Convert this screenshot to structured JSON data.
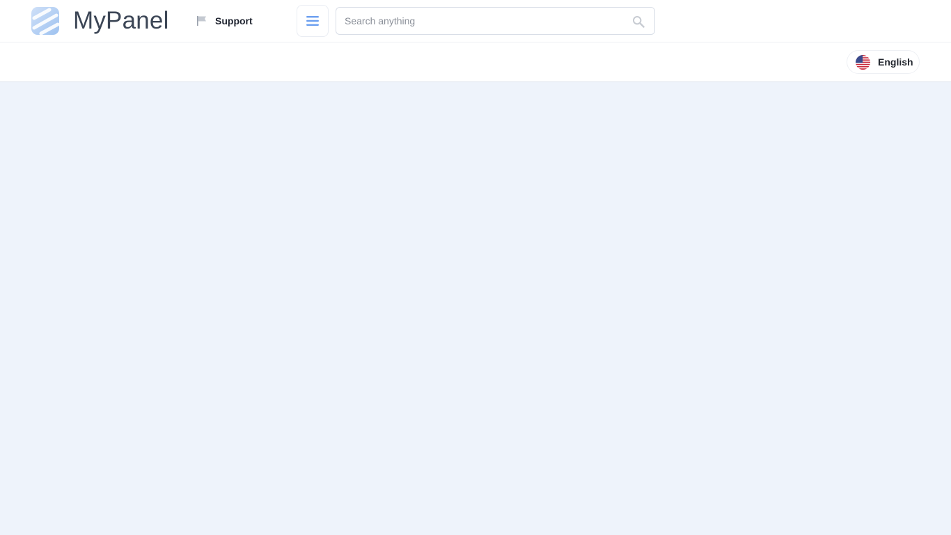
{
  "header": {
    "brand_name": "MyPanel",
    "logo_icon": "brand-logo-icon",
    "support_label": "Support",
    "support_icon": "flag-icon",
    "menu_icon": "hamburger-menu-icon",
    "search": {
      "placeholder": "Search anything",
      "value": "",
      "icon": "search-icon"
    }
  },
  "subbar": {
    "language_label": "English",
    "language_icon": "us-flag-icon"
  },
  "colors": {
    "accent": "#4a86e8",
    "brand_text": "#3c4656",
    "page_background": "#eef3fb"
  }
}
